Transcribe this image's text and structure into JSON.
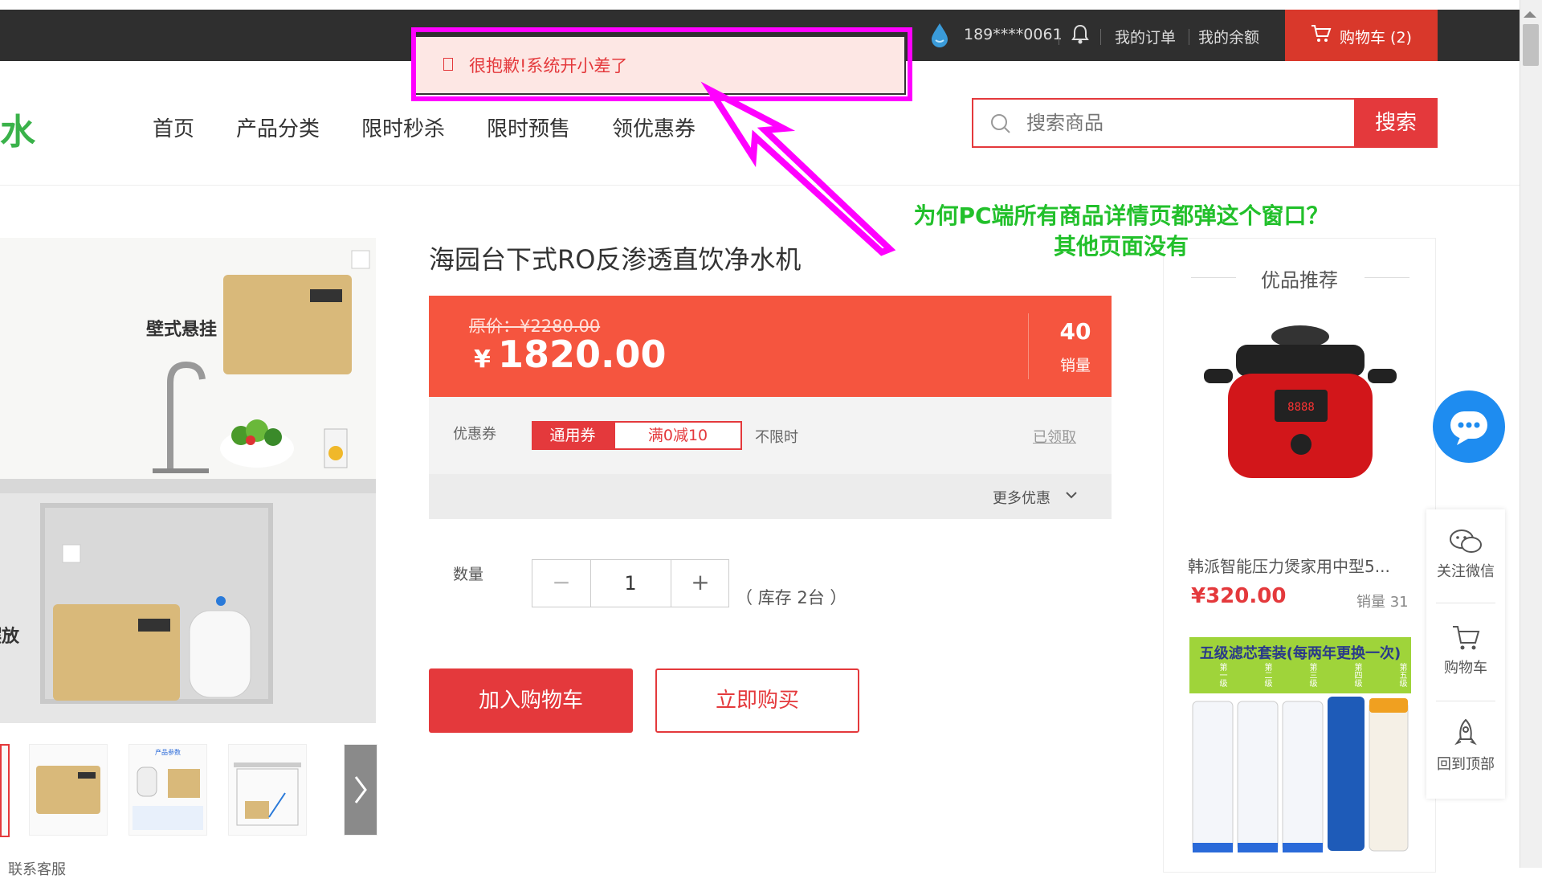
{
  "topbar": {
    "phone": "189****0061",
    "orders": "我的订单",
    "balance": "我的余额",
    "cart": "购物车 (2)"
  },
  "toast": {
    "message": "很抱歉!系统开小差了"
  },
  "header": {
    "logo_text": "净水",
    "nav": [
      "首页",
      "产品分类",
      "限时秒杀",
      "限时预售",
      "领优惠券"
    ],
    "search_placeholder": "搜索商品",
    "search_button": "搜索"
  },
  "annotation": {
    "line1": "为何PC端所有商品详情页都弹这个窗口？",
    "line2": "其他页面没有"
  },
  "gallery": {
    "label1": "壁式悬挂",
    "label2": "摆放",
    "contact": "联系客服",
    "thumb_caption": "产品参数"
  },
  "product": {
    "title": "海园台下式RO反渗透直饮净水机",
    "original_price": "原价：¥2280.00",
    "currency": "¥",
    "price": "1820.00",
    "sales_count": "40",
    "sales_label": "销量",
    "coupon_label": "优惠券",
    "coupon_tag": "通用券",
    "coupon_value": "满0减10",
    "coupon_time": "不限时",
    "coupon_status": "已领取",
    "more_coupons": "更多优惠",
    "quantity_label": "数量",
    "quantity": "1",
    "stock": "（ 库存 2台 ）",
    "add_to_cart": "加入购物车",
    "buy_now": "立即购买"
  },
  "recommend": {
    "title": "优品推荐",
    "item1_name": "韩派智能压力煲家用中型5...",
    "item1_price": "¥320.00",
    "item1_sales": "销量 31",
    "item2_banner": "五级滤芯套装(每两年更换一次)",
    "item2_stages": [
      "第一级",
      "第二级",
      "第三级",
      "第四级",
      "第五级"
    ]
  },
  "sidebar": {
    "wechat": "关注微信",
    "cart": "购物车",
    "top": "回到顶部"
  },
  "colors": {
    "accent": "#e4393c",
    "price_bg": "#f5553f",
    "topbar": "#2f2f2f",
    "annotation": "#22c02b",
    "highlight": "#ff00ff",
    "chat": "#1e8cf0"
  }
}
